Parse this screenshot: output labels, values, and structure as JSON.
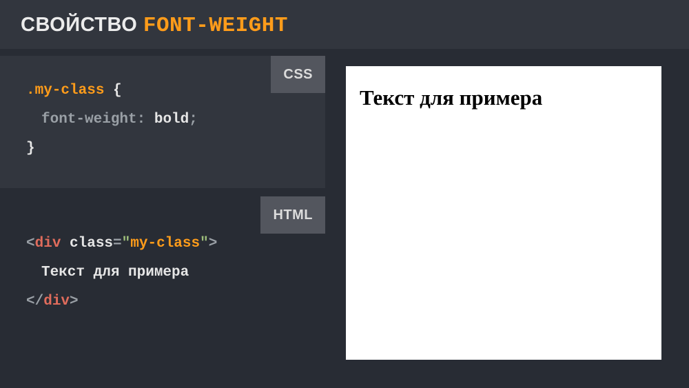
{
  "header": {
    "title_prefix": "СВОЙСТВО ",
    "title_property": "FONT-WEIGHT"
  },
  "labels": {
    "css": "CSS",
    "html": "HTML"
  },
  "css_code": {
    "selector": ".my-class",
    "open_brace": " {",
    "property": "font-weight",
    "colon": ": ",
    "value": "bold",
    "semicolon": ";",
    "close_brace": "}"
  },
  "html_code": {
    "lt1": "<",
    "tag_open": "div",
    "attr_name": " class",
    "eq": "=",
    "quote1": "\"",
    "attr_value": "my-class",
    "quote2": "\"",
    "gt1": ">",
    "content": "Текст для примера",
    "lt2": "<",
    "slash": "/",
    "tag_close": "div",
    "gt2": ">"
  },
  "preview": {
    "text": "Текст для примера"
  }
}
